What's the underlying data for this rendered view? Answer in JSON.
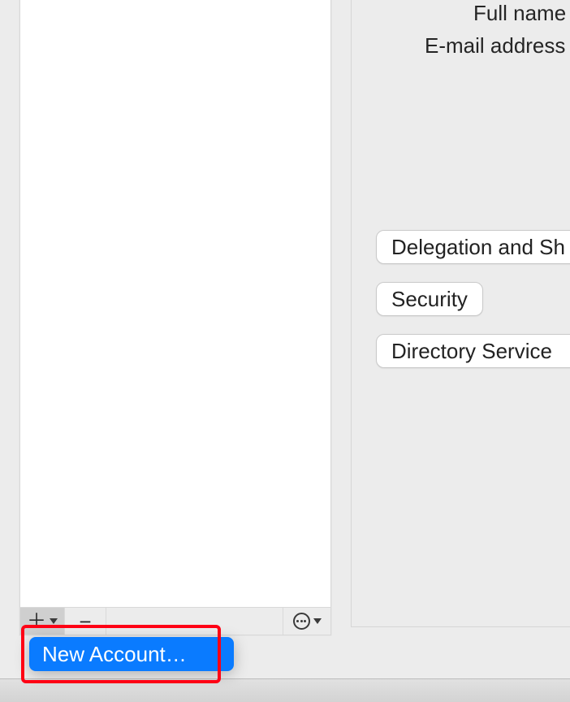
{
  "detail": {
    "fullname_label": "Full name",
    "email_label": "E-mail address"
  },
  "sections": {
    "delegation": "Delegation and Sh",
    "security": "Security",
    "directory": "Directory Service"
  },
  "popup": {
    "new_account": "New Account…"
  }
}
